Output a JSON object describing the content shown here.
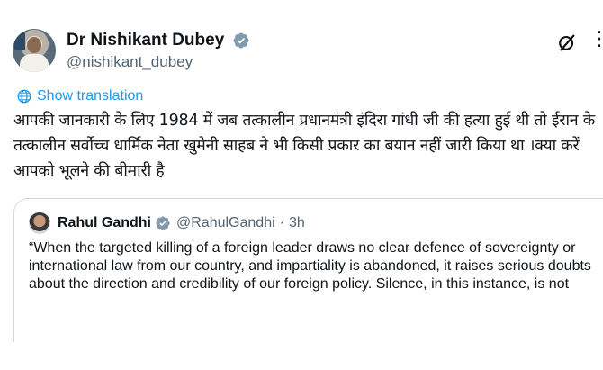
{
  "author": {
    "display_name": "Dr Nishikant Dubey",
    "handle": "@nishikant_dubey"
  },
  "translate_label": "Show translation",
  "tweet_text": "आपकी जानकारी के लिए 1984 में जब तत्कालीन प्रधानमंत्री इंदिरा गांधी जी की हत्या हुई थी तो ईरान के तत्कालीन सर्वोच्च धार्मिक नेता खुमेनी साहब ने भी किसी प्रकार का बयान नहीं जारी किया था ।क्या करें आपको भूलने की बीमारी है",
  "quote": {
    "display_name": "Rahul Gandhi",
    "handle": "@RahulGandhi",
    "separator": "·",
    "time": "3h",
    "text": "“When the targeted killing of a foreign leader draws no clear defence of sovereignty or international law from our country, and impartiality is abandoned, it raises serious doubts about the direction and credibility of our foreign policy. Silence, in this instance, is not"
  },
  "colors": {
    "accent": "#1d9bf0",
    "secondary_text": "#536471",
    "border": "#cfd9de"
  },
  "icons": {
    "verified": "verified-badge-icon",
    "grok": "grok-icon",
    "more": "more-icon",
    "globe": "globe-icon"
  }
}
